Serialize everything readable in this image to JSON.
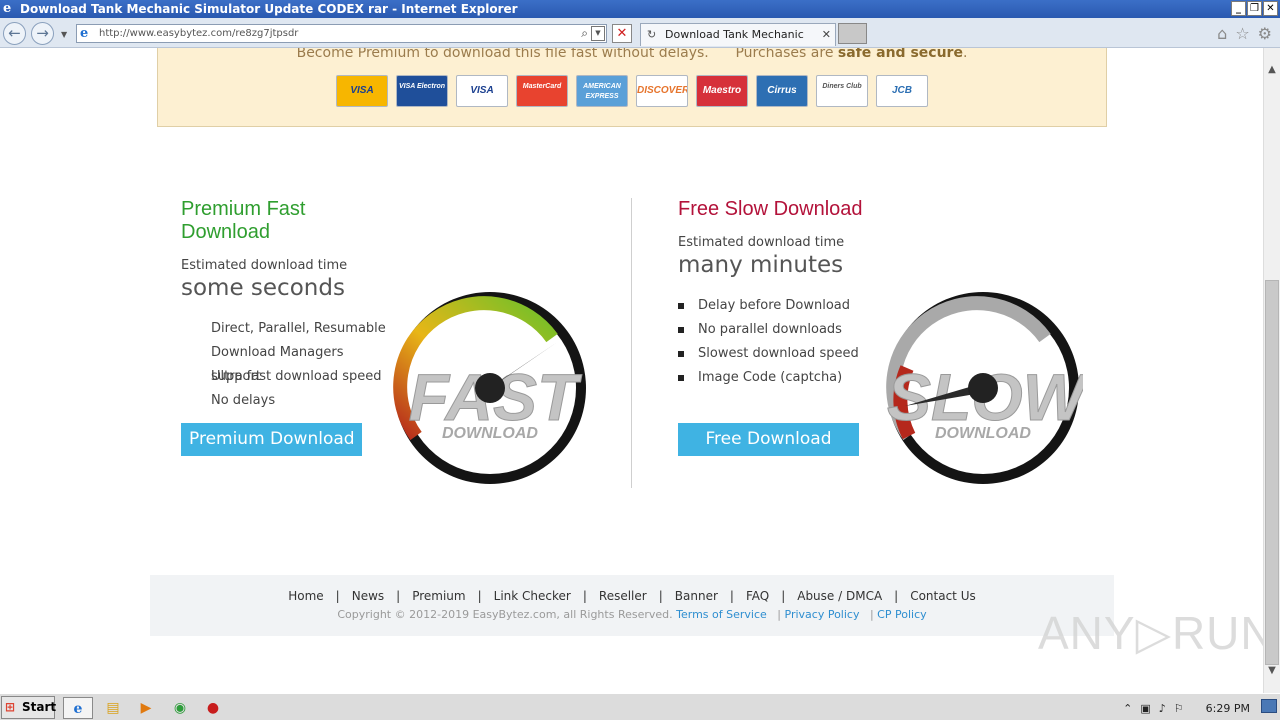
{
  "window": {
    "title": "Download Tank Mechanic Simulator Update CODEX rar - Internet Explorer",
    "controls": [
      "_",
      "❐",
      "✕"
    ]
  },
  "browser": {
    "url": "http://www.easybytez.com/re8zg7jtpsdr",
    "tab_label": "Download Tank Mechanic Sim...",
    "back_glyph": "←",
    "forward_glyph": "→"
  },
  "banner": {
    "text_1": "Become Premium to download this file fast without delays.",
    "text_2": "Purchases are ",
    "text_strong": "safe and secure",
    "text_end": ".",
    "cards": [
      {
        "label": "VISA",
        "color": "#f7b600",
        "fg": "#1a3f8f"
      },
      {
        "label": "VISA Electron",
        "color": "#1f4f9a",
        "fg": "#ffffff"
      },
      {
        "label": "VISA",
        "color": "#ffffff",
        "fg": "#1a3f8f"
      },
      {
        "label": "MasterCard",
        "color": "#e8432f",
        "fg": "#ffffff"
      },
      {
        "label": "AMERICAN EXPRESS",
        "color": "#5aa0d8",
        "fg": "#ffffff"
      },
      {
        "label": "DISCOVER",
        "color": "#ffffff",
        "fg": "#e6742c"
      },
      {
        "label": "Maestro",
        "color": "#d6303a",
        "fg": "#ffffff"
      },
      {
        "label": "Cirrus",
        "color": "#2d6fb3",
        "fg": "#ffffff"
      },
      {
        "label": "Diners Club",
        "color": "#ffffff",
        "fg": "#555555"
      },
      {
        "label": "JCB",
        "color": "#ffffff",
        "fg": "#2c6fb3"
      }
    ]
  },
  "premium": {
    "title": "Premium Fast Download",
    "title_color": "#2f9e2f",
    "est_label": "Estimated download time",
    "est_value": "some seconds",
    "features": [
      "Direct, Parallel, Resumable",
      "Download Managers support",
      "Ultra fast download speed",
      "No delays"
    ],
    "button": "Premium Download",
    "gauge_word": "FAST",
    "gauge_sub": "DOWNLOAD"
  },
  "free": {
    "title": "Free Slow Download",
    "title_color": "#b3123a",
    "est_label": "Estimated download time",
    "est_value": "many minutes",
    "features": [
      "Delay before Download",
      "No parallel downloads",
      "Slowest download speed",
      "Image Code (captcha)"
    ],
    "button": "Free Download",
    "gauge_word": "SLOW",
    "gauge_sub": "DOWNLOAD"
  },
  "footer": {
    "links": [
      "Home",
      "News",
      "Premium",
      "Link Checker",
      "Reseller",
      "Banner",
      "FAQ",
      "Abuse / DMCA",
      "Contact Us"
    ],
    "copyright": "Copyright © 2012-2019 EasyBytez.com, all Rights Reserved.",
    "tos": "Terms of Service",
    "privacy": "Privacy Policy",
    "cp": "CP Policy"
  },
  "watermark": "ANY▷RUN",
  "taskbar": {
    "start": "Start",
    "clock": "6:29 PM"
  }
}
